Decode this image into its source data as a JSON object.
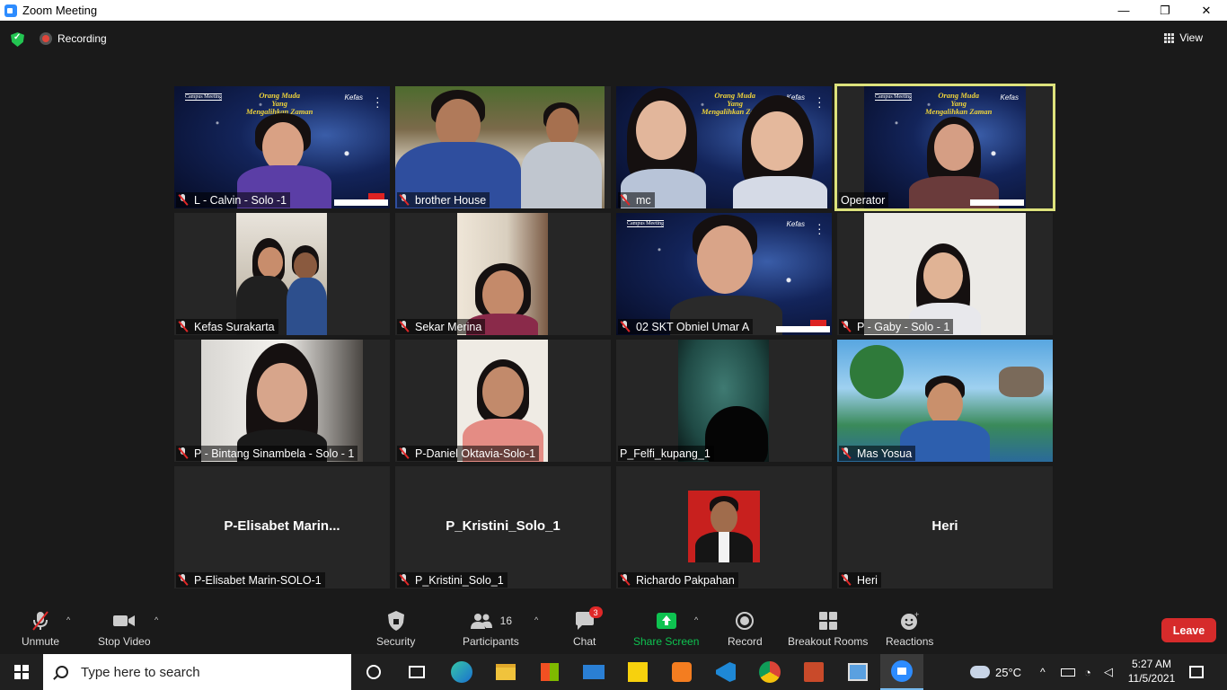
{
  "window": {
    "title": "Zoom Meeting",
    "minimize": "—",
    "maximize": "❐",
    "close": "✕"
  },
  "topbar": {
    "recording_label": "Recording",
    "view_label": "View"
  },
  "overlay": {
    "campus": "Campus Meeting",
    "theme_line1": "Orang Muda",
    "theme_line2": "Yang",
    "theme_line3": "Mengalihkan Zaman",
    "brand": "Kefas"
  },
  "participants": [
    {
      "name": "L - Calvin - Solo -1",
      "muted": true
    },
    {
      "name": "brother House",
      "muted": true
    },
    {
      "name": "mc",
      "muted": true
    },
    {
      "name": "Operator",
      "muted": false,
      "active_speaker": true
    },
    {
      "name": "Kefas Surakarta",
      "muted": true
    },
    {
      "name": "Sekar Merina",
      "muted": true
    },
    {
      "name": "02 SKT Obniel Umar A",
      "muted": true
    },
    {
      "name": "P - Gaby - Solo - 1",
      "muted": true
    },
    {
      "name": "P - Bintang Sinambela - Solo - 1",
      "muted": true
    },
    {
      "name": "P-Daniel Oktavia-Solo-1",
      "muted": true
    },
    {
      "name": "P_Felfi_kupang_1",
      "muted": false
    },
    {
      "name": "Mas Yosua",
      "muted": true
    },
    {
      "name": "P-Elisabet Marin-SOLO-1",
      "display": "P-Elisabet  Marin...",
      "muted": true
    },
    {
      "name": "P_Kristini_Solo_1",
      "display": "P_Kristini_Solo_1",
      "muted": true
    },
    {
      "name": "Richardo Pakpahan",
      "muted": true
    },
    {
      "name": "Heri",
      "display": "Heri",
      "muted": true
    }
  ],
  "toolbar": {
    "unmute": "Unmute",
    "stop_video": "Stop Video",
    "security": "Security",
    "participants": "Participants",
    "participant_count": "16",
    "chat": "Chat",
    "chat_badge": "3",
    "share_screen": "Share Screen",
    "record": "Record",
    "breakout_rooms": "Breakout Rooms",
    "reactions": "Reactions",
    "leave": "Leave"
  },
  "taskbar": {
    "search_placeholder": "Type here to search",
    "weather": "25°C",
    "time": "5:27 AM",
    "date": "11/5/2021"
  },
  "colors": {
    "accent_green": "#23c552",
    "share_green": "#0ec250",
    "leave_red": "#d62b2b",
    "active_border": "#dde27c"
  }
}
